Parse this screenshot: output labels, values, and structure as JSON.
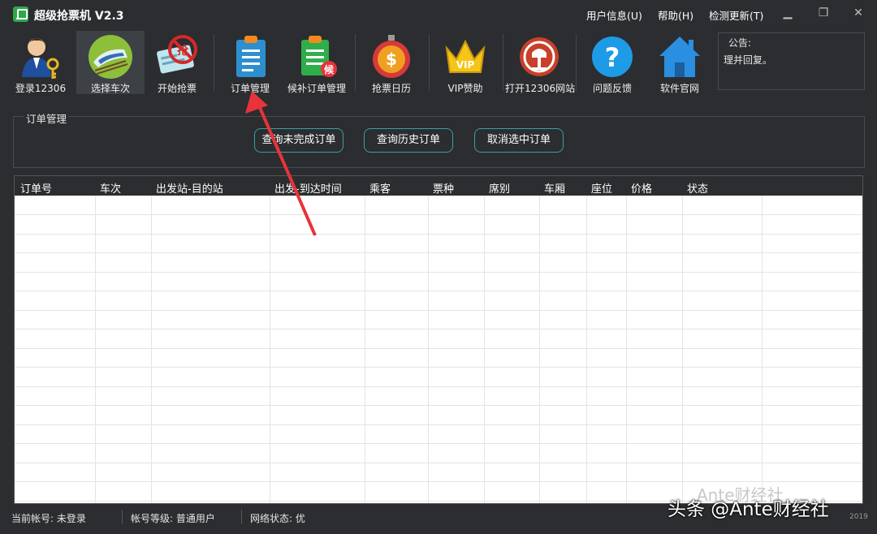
{
  "app": {
    "title": "超级抢票机 V2.3"
  },
  "menu": {
    "user_info": "用户信息(U)",
    "help": "帮助(H)",
    "check_update": "检测更新(T)"
  },
  "toolbar": {
    "items": [
      {
        "label": "登录12306",
        "icon": "user-key-icon"
      },
      {
        "label": "选择车次",
        "icon": "train-icon"
      },
      {
        "label": "开始抢票",
        "icon": "ticket-grab-icon"
      },
      {
        "label": "订单管理",
        "icon": "order-doc-icon"
      },
      {
        "label": "候补订单管理",
        "icon": "waitlist-doc-icon"
      },
      {
        "label": "抢票日历",
        "icon": "stopwatch-icon"
      },
      {
        "label": "VIP赞助",
        "icon": "crown-icon"
      },
      {
        "label": "打开12306网站",
        "icon": "railway-logo-icon"
      },
      {
        "label": "问题反馈",
        "icon": "question-icon"
      },
      {
        "label": "软件官网",
        "icon": "home-icon"
      }
    ],
    "active_index": 1
  },
  "notice": {
    "title": "公告:",
    "body": "理并回复。"
  },
  "orders": {
    "group_title": "订单管理",
    "buttons": {
      "query_unfinished": "查询未完成订单",
      "query_history": "查询历史订单",
      "cancel_selected": "取消选中订单"
    },
    "columns": [
      "订单号",
      "车次",
      "出发站-目的站",
      "出发-到达时间",
      "乘客",
      "票种",
      "席别",
      "车厢",
      "座位",
      "价格",
      "状态"
    ],
    "rows": []
  },
  "status": {
    "account": "当前帐号: 未登录",
    "level": "帐号等级: 普通用户",
    "network": "网络状态: 优",
    "year": "2019"
  },
  "watermark": {
    "text": "头条 @Ante财经社",
    "ghost": "Ante财经社"
  },
  "colors": {
    "background": "#2b2d30",
    "button_border": "#3aa0a0",
    "arrow": "#e8333a",
    "table_bg": "#ffffff"
  }
}
